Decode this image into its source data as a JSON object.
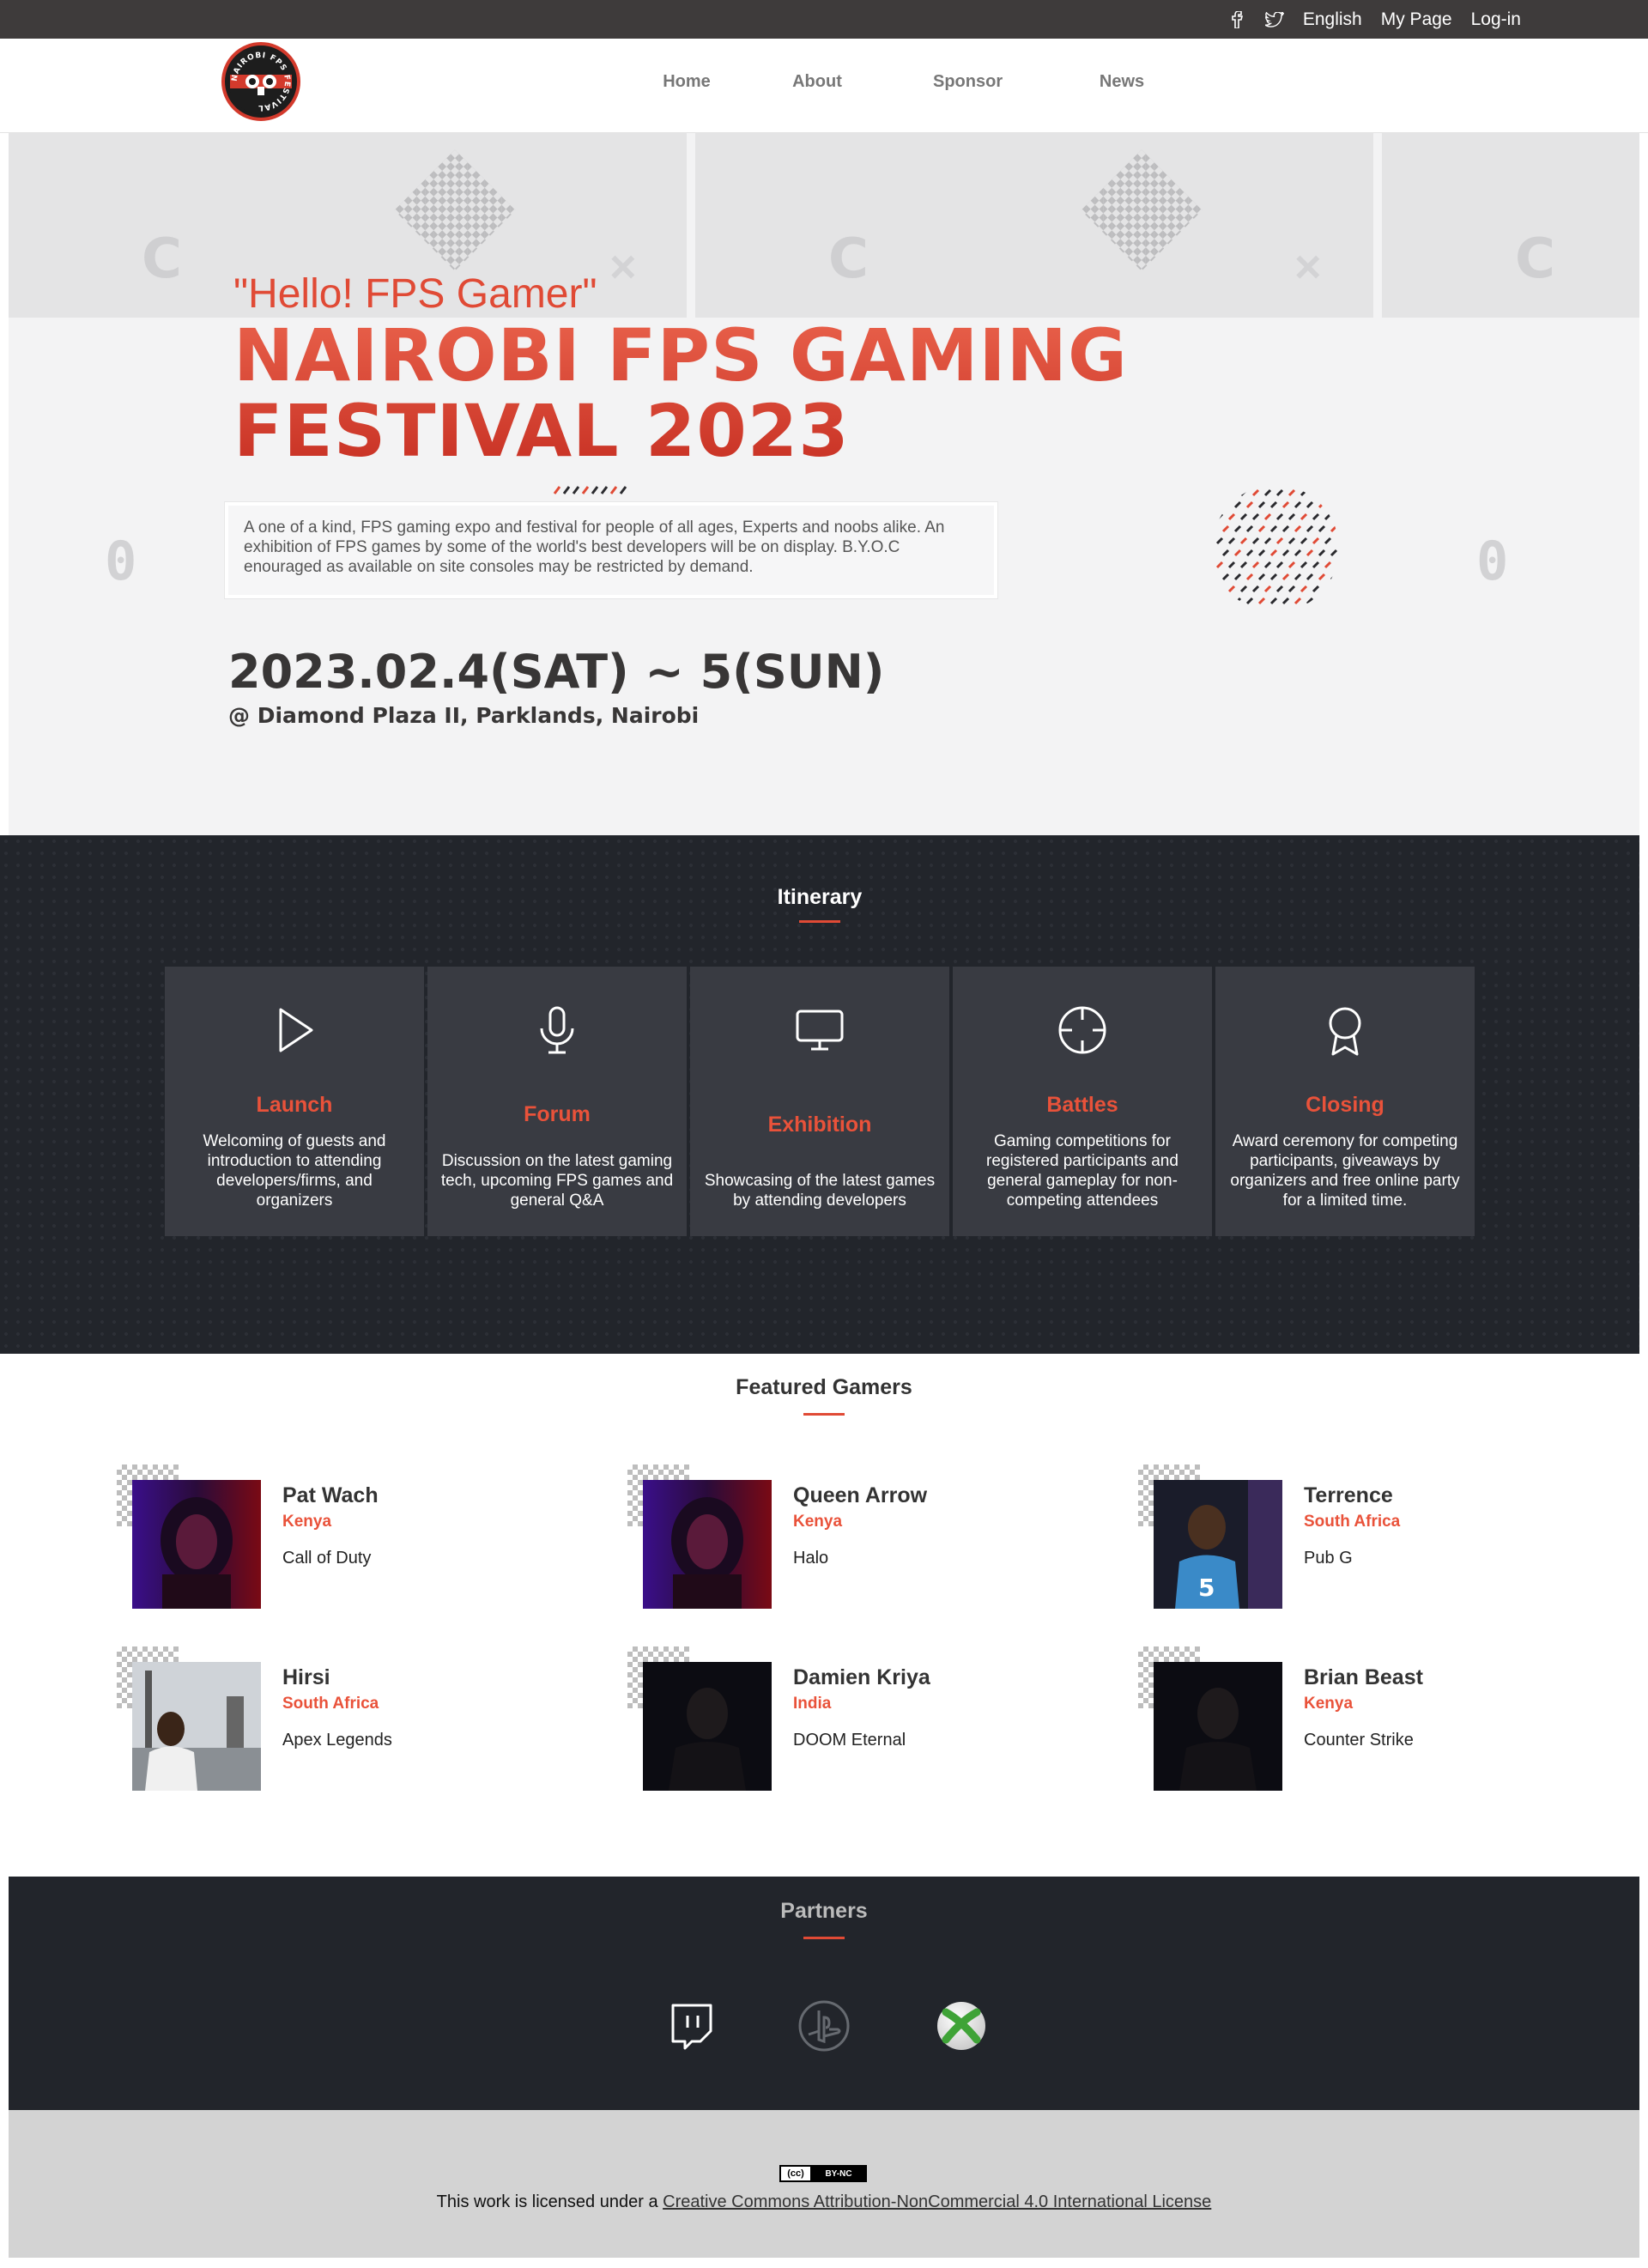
{
  "topbar": {
    "icons": [
      "facebook-icon",
      "twitter-icon"
    ],
    "language": "English",
    "mypage": "My Page",
    "login": "Log-in"
  },
  "nav": {
    "logo_text": "NAIROBI FPS FESTIVAL",
    "items": [
      {
        "label": "Home"
      },
      {
        "label": "About"
      },
      {
        "label": "Sponsor"
      },
      {
        "label": "News"
      }
    ]
  },
  "hero": {
    "greeting": "\"Hello! FPS Gamer\"",
    "title_line1": "NAIROBI FPS GAMING",
    "title_line2": "FESTIVAL 2023",
    "description": "A one of a kind, FPS gaming expo and festival for people of all ages, Experts and noobs alike. An exhibition of FPS games by some of the world's best developers will be on display. B.Y.O.C enouraged as available on site consoles may be restricted by demand.",
    "dates": "2023.02.4(SAT) ~ 5(SUN)",
    "venue": "@ Diamond Plaza II, Parklands, Nairobi"
  },
  "itinerary": {
    "title": "Itinerary",
    "items": [
      {
        "icon": "play-icon",
        "title": "Launch",
        "desc": "Welcoming of guests and introduction to attending developers/firms, and organizers"
      },
      {
        "icon": "microphone-icon",
        "title": "Forum",
        "desc": "Discussion on the latest gaming tech, upcoming FPS games and general Q&A"
      },
      {
        "icon": "monitor-icon",
        "title": "Exhibition",
        "desc": "Showcasing of the latest games by attending developers"
      },
      {
        "icon": "crosshair-icon",
        "title": "Battles",
        "desc": "Gaming competitions for registered participants and general gameplay for non-competing attendees"
      },
      {
        "icon": "award-icon",
        "title": "Closing",
        "desc": "Award ceremony for competing participants, giveaways by organizers and free online party for a limited time."
      }
    ]
  },
  "featured": {
    "title": "Featured Gamers",
    "gamers": [
      {
        "name": "Pat Wach",
        "country": "Kenya",
        "game": "Call of Duty"
      },
      {
        "name": "Queen Arrow",
        "country": "Kenya",
        "game": "Halo"
      },
      {
        "name": "Terrence",
        "country": "South Africa",
        "game": "Pub G"
      },
      {
        "name": "Hirsi",
        "country": "South Africa",
        "game": "Apex Legends"
      },
      {
        "name": "Damien Kriya",
        "country": "India",
        "game": "DOOM Eternal"
      },
      {
        "name": "Brian Beast",
        "country": "Kenya",
        "game": "Counter Strike"
      }
    ]
  },
  "partners": {
    "title": "Partners",
    "logos": [
      "twitch-icon",
      "playstation-icon",
      "xbox-icon"
    ]
  },
  "footer": {
    "cc_badge_left": "(cc)",
    "cc_badge_right": "BY-NC",
    "text": "This work is licensed under a ",
    "link": "Creative Commons Attribution-NonCommercial 4.0 International License"
  },
  "colors": {
    "accent": "#e9523a",
    "dark": "#22252b",
    "card": "#393b42",
    "topbar": "#3e3b3b"
  }
}
